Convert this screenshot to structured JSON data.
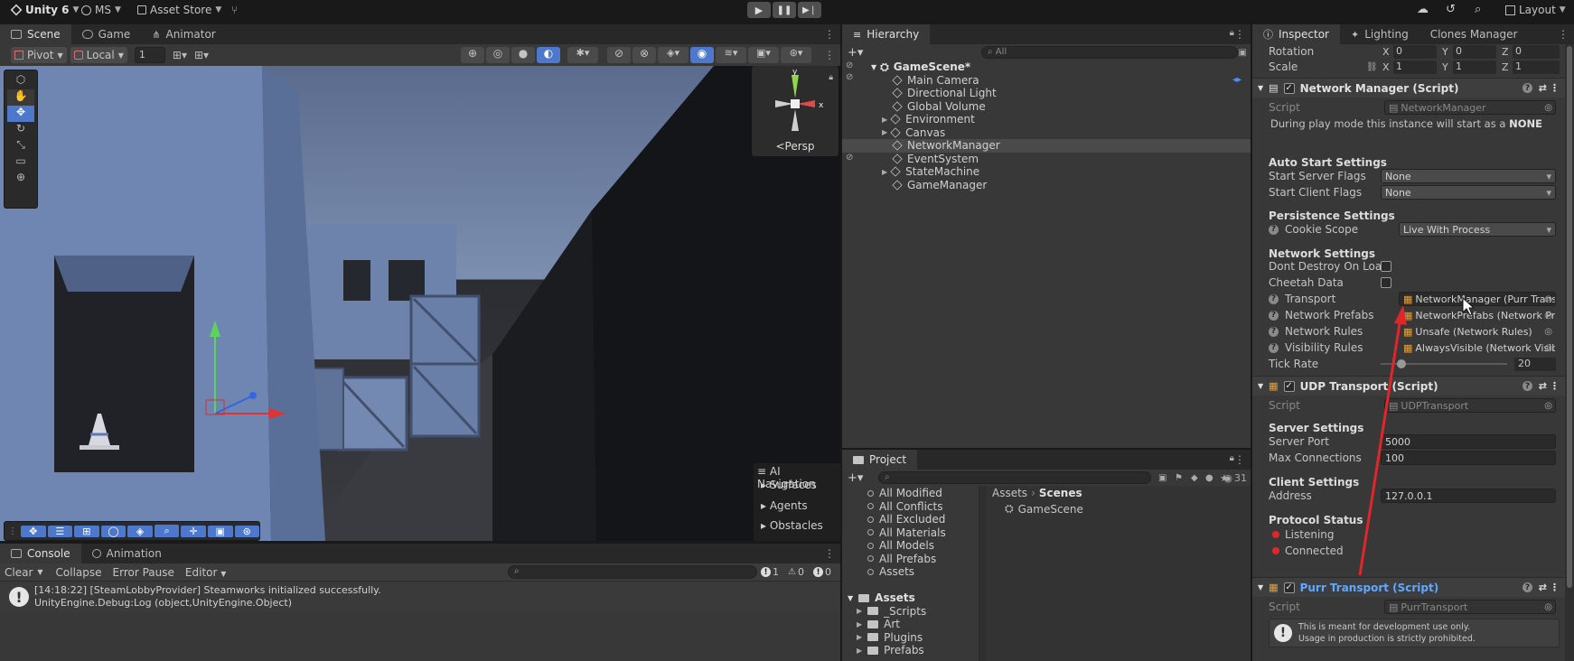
{
  "topbar": {
    "logo_label": "Unity 6",
    "account": "MS",
    "asset_store": "Asset Store",
    "layout": "Layout"
  },
  "scene_panel": {
    "tabs": [
      {
        "label": "Scene"
      },
      {
        "label": "Game"
      },
      {
        "label": "Animator"
      }
    ],
    "pivot": "Pivot",
    "local": "Local",
    "snap_value": "1",
    "persp": "Persp",
    "ai_nav": {
      "title": "AI Navigation",
      "items": [
        {
          "label": "Surfaces"
        },
        {
          "label": "Agents"
        },
        {
          "label": "Obstacles"
        }
      ]
    }
  },
  "console_panel": {
    "tabs": [
      {
        "label": "Console"
      },
      {
        "label": "Animation"
      }
    ],
    "clear": "Clear",
    "collapse": "Collapse",
    "error_pause": "Error Pause",
    "editor": "Editor",
    "count_log": "1",
    "count_warn": "0",
    "count_err": "0",
    "message_line1": "[14:18:22] [SteamLobbyProvider] Steamworks initialized successfully.",
    "message_line2": "UnityEngine.Debug:Log (object,UnityEngine.Object)"
  },
  "hierarchy": {
    "title": "Hierarchy",
    "search_placeholder": "All",
    "scene_name": "GameScene*",
    "items": [
      {
        "label": "Main Camera"
      },
      {
        "label": "Directional Light"
      },
      {
        "label": "Global Volume"
      },
      {
        "label": "Environment"
      },
      {
        "label": "Canvas"
      },
      {
        "label": "NetworkManager"
      },
      {
        "label": "EventSystem"
      },
      {
        "label": "StateMachine"
      },
      {
        "label": "GameManager"
      }
    ]
  },
  "project": {
    "title": "Project",
    "hidden_count": "31",
    "favorites": [
      {
        "label": "All Modified"
      },
      {
        "label": "All Conflicts"
      },
      {
        "label": "All Excluded"
      },
      {
        "label": "All Materials"
      },
      {
        "label": "All Models"
      },
      {
        "label": "All Prefabs"
      },
      {
        "label": "Assets"
      }
    ],
    "assets_root": "Assets",
    "folders": [
      {
        "label": "_Scripts"
      },
      {
        "label": "Art"
      },
      {
        "label": "Plugins"
      },
      {
        "label": "Prefabs"
      }
    ],
    "breadcrumb_root": "Assets",
    "breadcrumb_leaf": "Scenes",
    "files": [
      {
        "label": "GameScene"
      }
    ]
  },
  "inspector": {
    "tabs": [
      {
        "label": "Inspector"
      },
      {
        "label": "Lighting"
      },
      {
        "label": "Clones Manager"
      }
    ],
    "transform": {
      "rotation_label": "Rotation",
      "scale_label": "Scale",
      "rot": {
        "x": "0",
        "y": "0",
        "z": "0"
      },
      "scale": {
        "x": "1",
        "y": "1",
        "z": "1"
      }
    },
    "network_manager": {
      "title": "Network Manager (Script)",
      "script_label": "Script",
      "script_value": "NetworkManager",
      "play_note_prefix": "During play mode this instance will start as a",
      "play_note_bold": "NONE",
      "auto_start_header": "Auto Start Settings",
      "start_server_label": "Start Server Flags",
      "start_server_value": "None",
      "start_client_label": "Start Client Flags",
      "start_client_value": "None",
      "persistence_header": "Persistence Settings",
      "cookie_label": "Cookie Scope",
      "cookie_value": "Live With Process",
      "network_header": "Network Settings",
      "dont_destroy_label": "Dont Destroy On Load",
      "cheetah_label": "Cheetah Data",
      "transport_label": "Transport",
      "transport_value": "NetworkManager (Purr Trans",
      "prefabs_label": "Network Prefabs",
      "prefabs_value": "NetworkPrefabs (Network Pr",
      "rules_label": "Network Rules",
      "rules_value": "Unsafe (Network Rules)",
      "visibility_label": "Visibility Rules",
      "visibility_value": "AlwaysVisible (Network Visib",
      "tick_label": "Tick Rate",
      "tick_value": "20",
      "tick_fraction": 0.14
    },
    "udp": {
      "title": "UDP Transport (Script)",
      "script_label": "Script",
      "script_value": "UDPTransport",
      "server_header": "Server Settings",
      "port_label": "Server Port",
      "port_value": "5000",
      "maxconn_label": "Max Connections",
      "maxconn_value": "100",
      "client_header": "Client Settings",
      "address_label": "Address",
      "address_value": "127.0.0.1",
      "protocol_header": "Protocol Status",
      "listening": "Listening",
      "connected": "Connected"
    },
    "purr": {
      "title": "Purr Transport (Script)",
      "script_label": "Script",
      "script_value": "PurrTransport",
      "note_line1": "This is meant for development use only.",
      "note_line2": "Usage in production is strictly prohibited."
    }
  },
  "colors": {
    "accent": "#4d78cc",
    "selection": "#4a4a4a",
    "status_red": "#e0262b",
    "link_blue": "#5fa8ff"
  }
}
